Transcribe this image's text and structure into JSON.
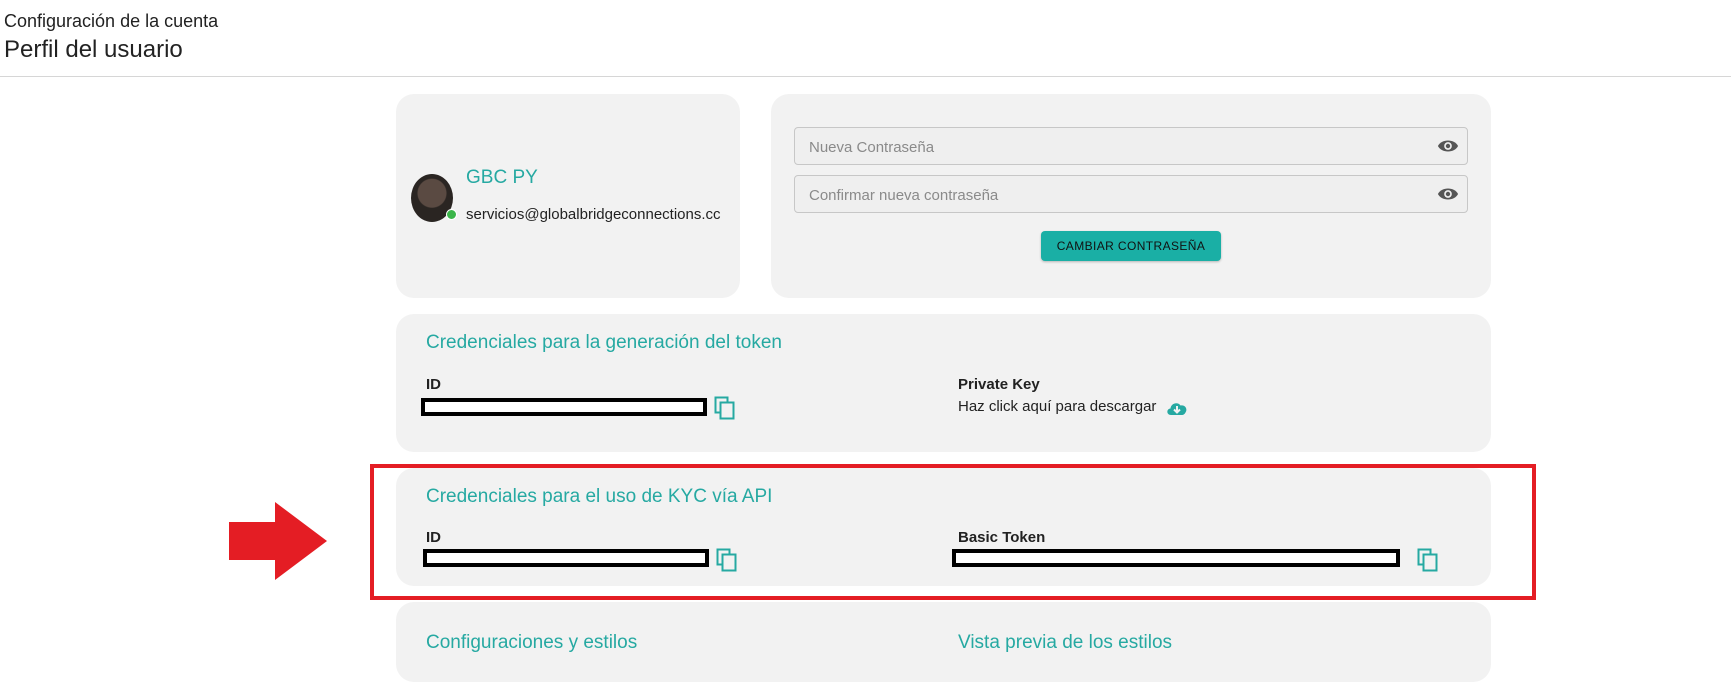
{
  "header": {
    "subtitle": "Configuración de la cuenta",
    "title": "Perfil del usuario"
  },
  "profile": {
    "name": "GBC PY",
    "email": "servicios@globalbridgeconnections.cc"
  },
  "password": {
    "new_placeholder": "Nueva Contraseña",
    "confirm_placeholder": "Confirmar nueva contraseña",
    "button_label": "CAMBIAR CONTRASEÑA"
  },
  "token_section": {
    "title": "Credenciales para la generación del token",
    "id_label": "ID",
    "private_key_label": "Private Key",
    "download_text": "Haz click aquí para descargar"
  },
  "kyc_section": {
    "title": "Credenciales para el uso de KYC vía API",
    "id_label": "ID",
    "basic_token_label": "Basic Token"
  },
  "bottom_section": {
    "left_title": "Configuraciones y estilos",
    "right_title": "Vista previa de los estilos"
  },
  "colors": {
    "accent": "#26a9a2",
    "button": "#1aafa5",
    "highlight": "#e41d24",
    "card": "#f2f2f2"
  }
}
